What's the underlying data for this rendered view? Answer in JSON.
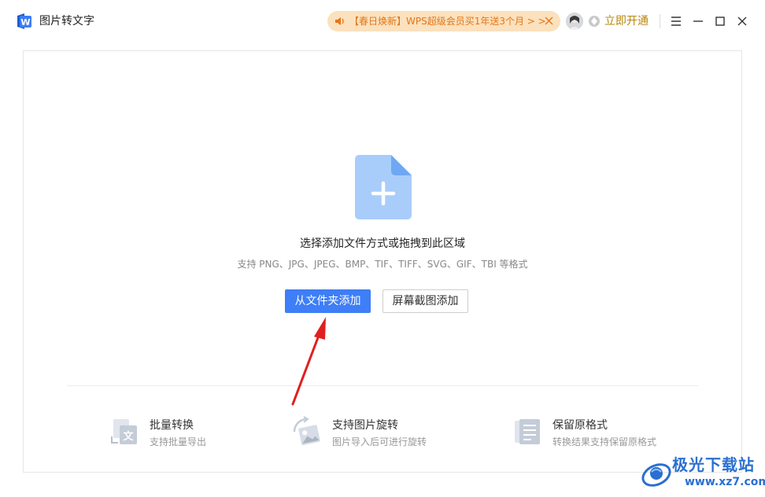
{
  "app": {
    "title": "图片转文字",
    "icon": "wps-word-icon"
  },
  "promo": {
    "text": "【春日焕新】WPS超级会员买1年送3个月 > >",
    "text_color": "#e27619",
    "bg_color": "#fbe1bd"
  },
  "header": {
    "vip_label": "立即开通",
    "vip_color": "#b8860b"
  },
  "window_controls": {
    "menu": "menu-icon",
    "minimize": "minimize-icon",
    "maximize": "maximize-icon",
    "close": "close-icon"
  },
  "drop_zone": {
    "title": "选择添加文件方式或拖拽到此区域",
    "subtitle": "支持 PNG、JPG、JPEG、BMP、TIF、TIFF、SVG、GIF、TBI 等格式",
    "primary_button": "从文件夹添加",
    "secondary_button": "屏幕截图添加",
    "accent_color": "#3e7ef7"
  },
  "features": [
    {
      "title": "批量转换",
      "desc": "支持批量导出",
      "icon": "batch-convert-icon"
    },
    {
      "title": "支持图片旋转",
      "desc": "图片导入后可进行旋转",
      "icon": "image-rotate-icon"
    },
    {
      "title": "保留原格式",
      "desc": "转换结果支持保留原格式",
      "icon": "keep-format-icon"
    }
  ],
  "watermark": {
    "name": "极光下载站",
    "url": "www.xz7.com"
  }
}
